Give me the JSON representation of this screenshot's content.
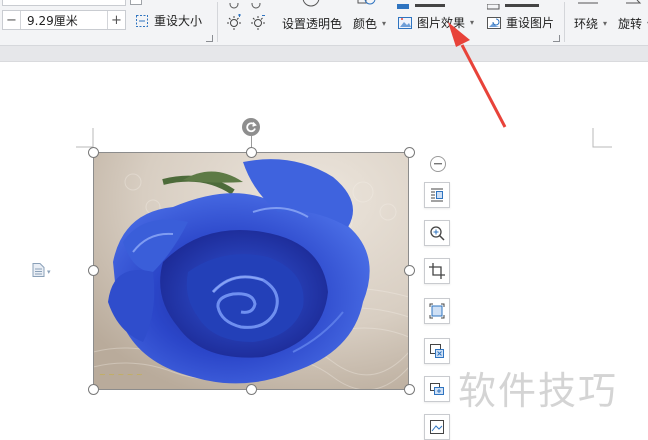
{
  "ribbon": {
    "width_value": "9.29厘米",
    "minus_label": "−",
    "plus_label": "+",
    "reset_size_label": "重设大小",
    "set_transparent_label": "设置透明色",
    "color_label": "颜色",
    "picture_effect_label": "图片效果",
    "reset_picture_label": "重设图片",
    "wrap_label": "环绕",
    "rotate_label": "旋转"
  },
  "document": {
    "watermark_text": "软件技巧"
  },
  "colors": {
    "accent_red": "#e8433a",
    "icon_blue": "#2f74c0",
    "rose_blue": "#2b46c9"
  },
  "icons": {
    "brightness_up": "sun-plus-icon",
    "brightness_down": "sun-minus-icon",
    "transparent": "transparent-color-icon",
    "color": "color-icon",
    "picture_effect": "picture-effect-icon",
    "reset_picture": "reset-picture-icon",
    "wrap": "wrap-icon",
    "rotate": "rotate-icon",
    "reset_size": "reset-size-icon"
  }
}
